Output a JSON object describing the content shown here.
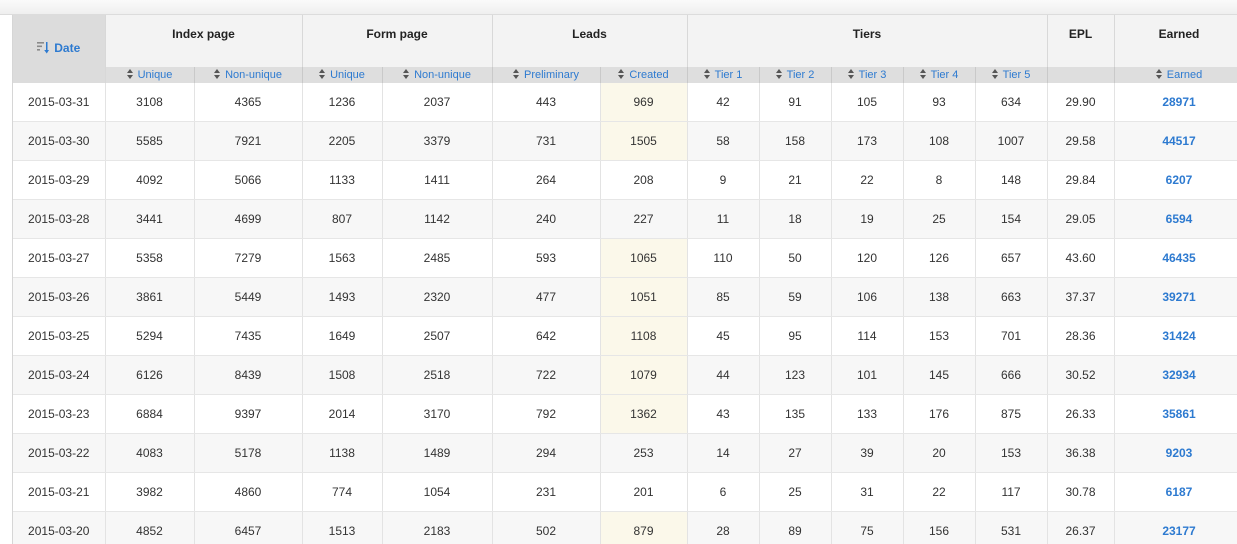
{
  "groups": {
    "date": "Date",
    "index_page": "Index page",
    "form_page": "Form page",
    "leads": "Leads",
    "tiers": "Tiers",
    "epl": "EPL",
    "earned": "Earned"
  },
  "subheaders": [
    "Unique",
    "Non-unique",
    "Unique",
    "Non-unique",
    "Preliminary",
    "Created",
    "Tier 1",
    "Tier 2",
    "Tier 3",
    "Tier 4",
    "Tier 5",
    "Earned"
  ],
  "rows": [
    [
      "2015-03-31",
      "3108",
      "4365",
      "1236",
      "2037",
      "443",
      "969",
      "42",
      "91",
      "105",
      "93",
      "634",
      "29.90",
      "28971"
    ],
    [
      "2015-03-30",
      "5585",
      "7921",
      "2205",
      "3379",
      "731",
      "1505",
      "58",
      "158",
      "173",
      "108",
      "1007",
      "29.58",
      "44517"
    ],
    [
      "2015-03-29",
      "4092",
      "5066",
      "1133",
      "1411",
      "264",
      "208",
      "9",
      "21",
      "22",
      "8",
      "148",
      "29.84",
      "6207"
    ],
    [
      "2015-03-28",
      "3441",
      "4699",
      "807",
      "1142",
      "240",
      "227",
      "11",
      "18",
      "19",
      "25",
      "154",
      "29.05",
      "6594"
    ],
    [
      "2015-03-27",
      "5358",
      "7279",
      "1563",
      "2485",
      "593",
      "1065",
      "110",
      "50",
      "120",
      "126",
      "657",
      "43.60",
      "46435"
    ],
    [
      "2015-03-26",
      "3861",
      "5449",
      "1493",
      "2320",
      "477",
      "1051",
      "85",
      "59",
      "106",
      "138",
      "663",
      "37.37",
      "39271"
    ],
    [
      "2015-03-25",
      "5294",
      "7435",
      "1649",
      "2507",
      "642",
      "1108",
      "45",
      "95",
      "114",
      "153",
      "701",
      "28.36",
      "31424"
    ],
    [
      "2015-03-24",
      "6126",
      "8439",
      "1508",
      "2518",
      "722",
      "1079",
      "44",
      "123",
      "101",
      "145",
      "666",
      "30.52",
      "32934"
    ],
    [
      "2015-03-23",
      "6884",
      "9397",
      "2014",
      "3170",
      "792",
      "1362",
      "43",
      "135",
      "133",
      "176",
      "875",
      "26.33",
      "35861"
    ],
    [
      "2015-03-22",
      "4083",
      "5178",
      "1138",
      "1489",
      "294",
      "253",
      "14",
      "27",
      "39",
      "20",
      "153",
      "36.38",
      "9203"
    ],
    [
      "2015-03-21",
      "3982",
      "4860",
      "774",
      "1054",
      "231",
      "201",
      "6",
      "25",
      "31",
      "22",
      "117",
      "30.78",
      "6187"
    ],
    [
      "2015-03-20",
      "4852",
      "6457",
      "1513",
      "2183",
      "502",
      "879",
      "28",
      "89",
      "75",
      "156",
      "531",
      "26.37",
      "23177"
    ]
  ],
  "highlight_rows": [
    0,
    1,
    4,
    5,
    6,
    7,
    8,
    11
  ],
  "colors": {
    "link": "#2d7ad0",
    "highlight_cell": "#fbf8ea",
    "header_bg": "#f3f3f3",
    "subheader_bg": "#dedede"
  },
  "icons": {
    "date_sort": "sort-descending-icon",
    "column_sort": "sort-arrows-icon"
  }
}
